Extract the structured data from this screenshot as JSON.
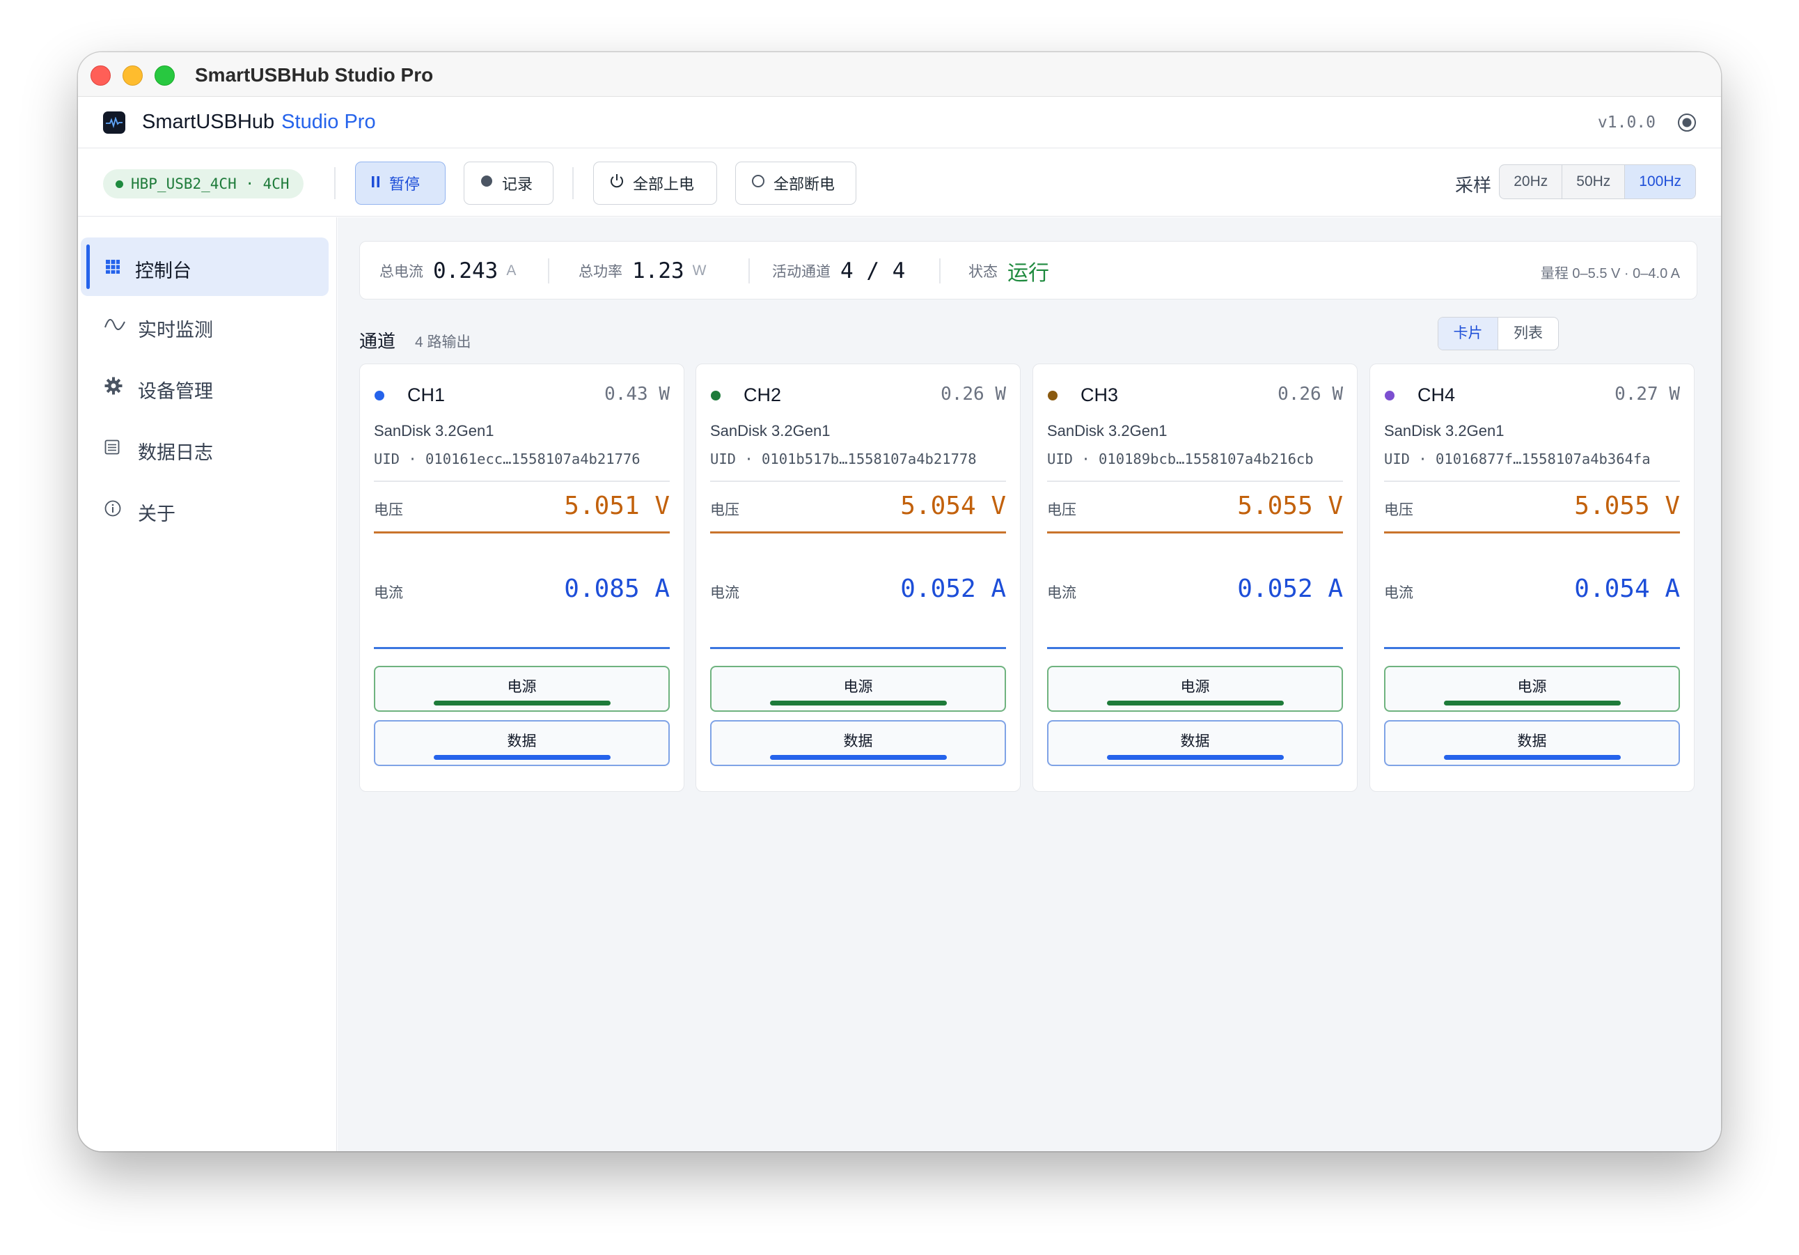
{
  "window": {
    "title": "SmartUSBHub Studio Pro"
  },
  "app": {
    "name": "SmartUSBHub",
    "edition": "Studio Pro",
    "version": "v1.0.0"
  },
  "toolbar": {
    "device": "HBP_USB2_4CH · 4CH",
    "pause_label": "暂停",
    "record_label": "记录",
    "power_all_on_label": "全部上电",
    "power_all_off_label": "全部断电",
    "sample_label": "采样",
    "sample_rates": [
      "20Hz",
      "50Hz",
      "100Hz"
    ],
    "sample_rate_selected": "100Hz"
  },
  "sidebar": {
    "items": [
      {
        "label": "控制台",
        "icon": "grid-icon",
        "active": true
      },
      {
        "label": "实时监测",
        "icon": "wave-icon",
        "active": false
      },
      {
        "label": "设备管理",
        "icon": "gear-icon",
        "active": false
      },
      {
        "label": "数据日志",
        "icon": "log-icon",
        "active": false
      },
      {
        "label": "关于",
        "icon": "info-icon",
        "active": false
      }
    ]
  },
  "stats": {
    "total_current_label": "总电流",
    "total_current": "0.243",
    "total_current_unit": "A",
    "total_power_label": "总功率",
    "total_power": "1.23",
    "total_power_unit": "W",
    "active_channels_label": "活动通道",
    "active_channels": "4 / 4",
    "status_label": "状态",
    "status": "运行",
    "range": "量程 0–5.5 V · 0–4.0 A"
  },
  "section": {
    "title": "通道",
    "subtitle": "4 路输出",
    "view_modes": [
      "卡片",
      "列表"
    ],
    "view_selected": "卡片"
  },
  "channels": [
    {
      "name": "CH1",
      "color": "#2563eb",
      "power": "0.43 W",
      "model": "SanDisk 3.2Gen1",
      "uid": "UID · 010161ecc…1558107a4b21776",
      "voltage_label": "电压",
      "voltage": "5.051 V",
      "current_label": "电流",
      "current": "0.085 A",
      "power_btn": "电源",
      "data_btn": "数据"
    },
    {
      "name": "CH2",
      "color": "#1e7b3a",
      "power": "0.26 W",
      "model": "SanDisk 3.2Gen1",
      "uid": "UID · 0101b517b…1558107a4b21778",
      "voltage_label": "电压",
      "voltage": "5.054 V",
      "current_label": "电流",
      "current": "0.052 A",
      "power_btn": "电源",
      "data_btn": "数据"
    },
    {
      "name": "CH3",
      "color": "#8a5a10",
      "power": "0.26 W",
      "model": "SanDisk 3.2Gen1",
      "uid": "UID · 010189bcb…1558107a4b216cb",
      "voltage_label": "电压",
      "voltage": "5.055 V",
      "current_label": "电流",
      "current": "0.052 A",
      "power_btn": "电源",
      "data_btn": "数据"
    },
    {
      "name": "CH4",
      "color": "#7c4fd0",
      "power": "0.27 W",
      "model": "SanDisk 3.2Gen1",
      "uid": "UID · 01016877f…1558107a4b364fa",
      "voltage_label": "电压",
      "voltage": "5.055 V",
      "current_label": "电流",
      "current": "0.054 A",
      "power_btn": "电源",
      "data_btn": "数据"
    }
  ]
}
